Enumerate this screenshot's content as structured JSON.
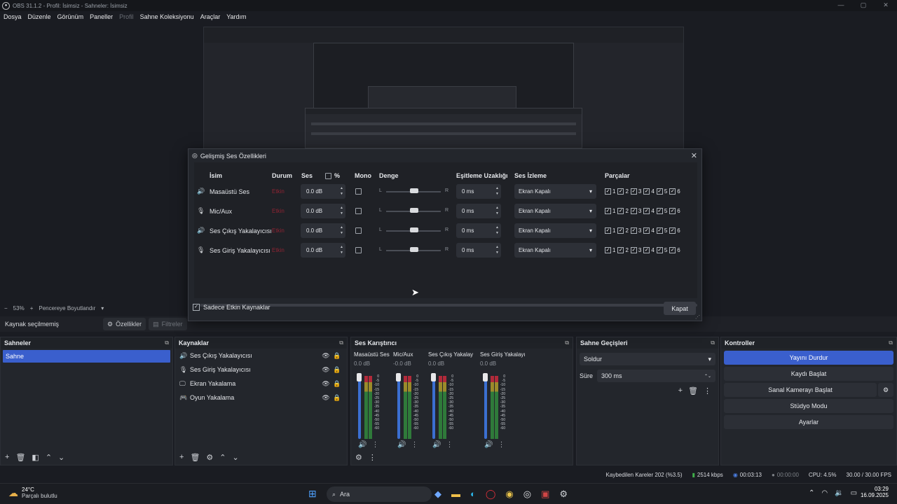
{
  "window": {
    "title": "OBS 31.1.2 - Profil: İsimsiz - Sahneler: İsimsiz"
  },
  "window_controls": {
    "minimize": "—",
    "maximize": "▢",
    "close": "✕"
  },
  "menu": [
    "Dosya",
    "Düzenle",
    "Görünüm",
    "Paneller",
    "Profil",
    "Sahne Koleksiyonu",
    "Araçlar",
    "Yardım"
  ],
  "zoom": {
    "minus": "−",
    "value": "53%",
    "plus": "+",
    "fit_label": "Pencereye Boyutlandır"
  },
  "source_toolbar": {
    "no_selection": "Kaynak seçilmemiş",
    "properties": "Özellikler",
    "filters": "Filtreler"
  },
  "scenes": {
    "title": "Sahneler",
    "items": [
      "Sahne"
    ]
  },
  "sources": {
    "title": "Kaynaklar",
    "items": [
      {
        "name": "Ses Çıkış Yakalayıcısı",
        "icon": "speaker-icon"
      },
      {
        "name": "Ses Giriş Yakalayıcısı",
        "icon": "mic-icon"
      },
      {
        "name": "Ekran Yakalama",
        "icon": "monitor-icon"
      },
      {
        "name": "Oyun Yakalama",
        "icon": "gamepad-icon"
      }
    ]
  },
  "mixer": {
    "title": "Ses Karıştırıcı",
    "channels": [
      {
        "name": "Masaüstü Ses",
        "db": "0.0 dB"
      },
      {
        "name": "Mic/Aux",
        "db": "-0.0 dB"
      },
      {
        "name": "Ses Çıkış Yakalayıcı",
        "db": "0.0 dB"
      },
      {
        "name": "Ses Giriş Yakalayıcı",
        "db": "0.0 dB"
      }
    ],
    "scale": [
      "0",
      "-5",
      "-10",
      "-15",
      "-20",
      "-25",
      "-30",
      "-35",
      "-40",
      "-45",
      "-50",
      "-55",
      "-60"
    ]
  },
  "transitions": {
    "title": "Sahne Geçişleri",
    "selected": "Soldur",
    "duration_label": "Süre",
    "duration": "300 ms"
  },
  "controls": {
    "title": "Kontroller",
    "buttons": [
      "Yayını Durdur",
      "Kaydı Başlat",
      "Sanal Kamerayı Başlat",
      "Stüdyo Modu",
      "Ayarlar"
    ]
  },
  "status": {
    "dropped": "Kaybedilen Kareler 202 (%3.5)",
    "bitrate": "2514 kbps",
    "stream_time": "00:03:13",
    "rec_time": "00:00:00",
    "cpu": "CPU: 4.5%",
    "fps": "30.00 / 30.00 FPS"
  },
  "taskbar": {
    "weather_temp": "24°C",
    "weather_desc": "Parçalı bulutlu",
    "search": "Ara",
    "time": "03:29",
    "date": "16.09.2025"
  },
  "dialog": {
    "title": "Gelişmiş Ses Özellikleri",
    "headers": {
      "name": "İsim",
      "status": "Durum",
      "volume": "Ses",
      "percent": "%",
      "mono": "Mono",
      "balance": "Denge",
      "sync": "Eşitleme Uzaklığı",
      "monitor": "Ses İzleme",
      "tracks": "Parçalar"
    },
    "balance_left": "L",
    "balance_right": "R",
    "rows": [
      {
        "name": "Masaüstü Ses",
        "status": "Etkin",
        "volume": "0.0 dB",
        "sync": "0 ms",
        "monitor": "Ekran Kapalı",
        "icon": "speaker-icon"
      },
      {
        "name": "Mic/Aux",
        "status": "Etkin",
        "volume": "0.0 dB",
        "sync": "0 ms",
        "monitor": "Ekran Kapalı",
        "icon": "mic-icon"
      },
      {
        "name": "Ses Çıkış Yakalayıcısı",
        "status": "Etkin",
        "volume": "0.0 dB",
        "sync": "0 ms",
        "monitor": "Ekran Kapalı",
        "icon": "speaker-icon"
      },
      {
        "name": "Ses Giriş Yakalayıcısı",
        "status": "Etkin",
        "volume": "0.0 dB",
        "sync": "0 ms",
        "monitor": "Ekran Kapalı",
        "icon": "mic-icon"
      }
    ],
    "tracks": [
      "1",
      "2",
      "3",
      "4",
      "5",
      "6"
    ],
    "footer_checkbox": "Sadece Etkin Kaynaklar",
    "close_button": "Kapat"
  }
}
